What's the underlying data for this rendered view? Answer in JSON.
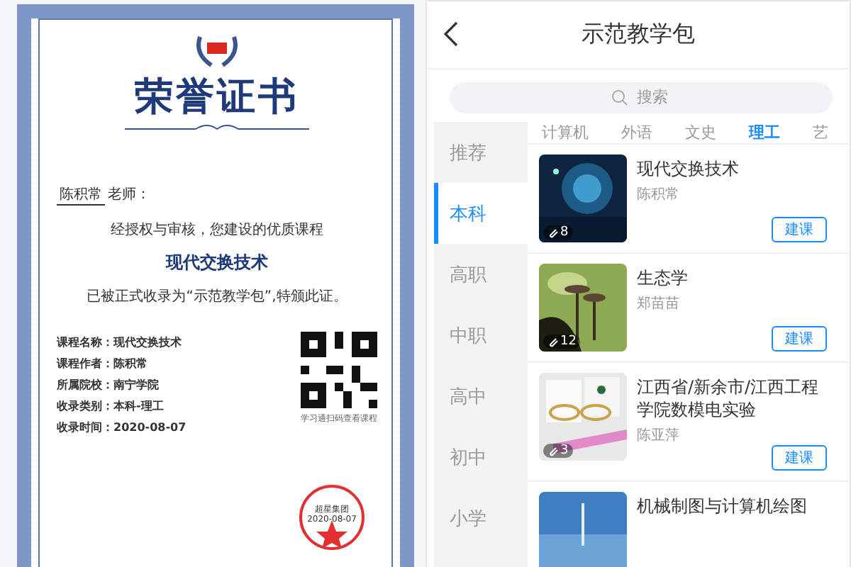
{
  "certificate": {
    "title": "荣誉证书",
    "recipient": "陈积常",
    "salutation": "老师：",
    "intro": "经授权与审核，您建设的优质课程",
    "course": "现代交换技术",
    "statement": "已被正式收录为“示范教学包”,特颁此证。",
    "fields": [
      {
        "label": "课程名称：",
        "value": "现代交换技术"
      },
      {
        "label": "课程作者：",
        "value": "陈积常"
      },
      {
        "label": "所属院校：",
        "value": "南宁学院"
      },
      {
        "label": "收录类别：",
        "value": "本科-理工"
      },
      {
        "label": "收录时间：",
        "value": "2020-08-07"
      }
    ],
    "qr_caption": "学习通扫码查看课程",
    "seal": {
      "name": "超星集团",
      "date": "2020-08-07"
    }
  },
  "app": {
    "title": "示范教学包",
    "search": {
      "placeholder": "搜索"
    },
    "levels": [
      {
        "label": "推荐",
        "selected": false
      },
      {
        "label": "本科",
        "selected": true
      },
      {
        "label": "高职",
        "selected": false
      },
      {
        "label": "中职",
        "selected": false
      },
      {
        "label": "高中",
        "selected": false
      },
      {
        "label": "初中",
        "selected": false
      },
      {
        "label": "小学",
        "selected": false
      }
    ],
    "subjects": [
      {
        "label": "计算机",
        "selected": false
      },
      {
        "label": "外语",
        "selected": false
      },
      {
        "label": "文史",
        "selected": false
      },
      {
        "label": "理工",
        "selected": true
      },
      {
        "label": "艺",
        "selected": false
      }
    ],
    "courses": [
      {
        "title": "现代交换技术",
        "author": "陈积常",
        "count": "8",
        "action": "建课"
      },
      {
        "title": "生态学",
        "author": "郑苗苗",
        "count": "12",
        "action": "建课"
      },
      {
        "title": "江西省/新余市/江西工程学院数模电实验",
        "author": "陈亚萍",
        "count": "3",
        "action": "建课"
      },
      {
        "title": "机械制图与计算机绘图"
      }
    ]
  }
}
